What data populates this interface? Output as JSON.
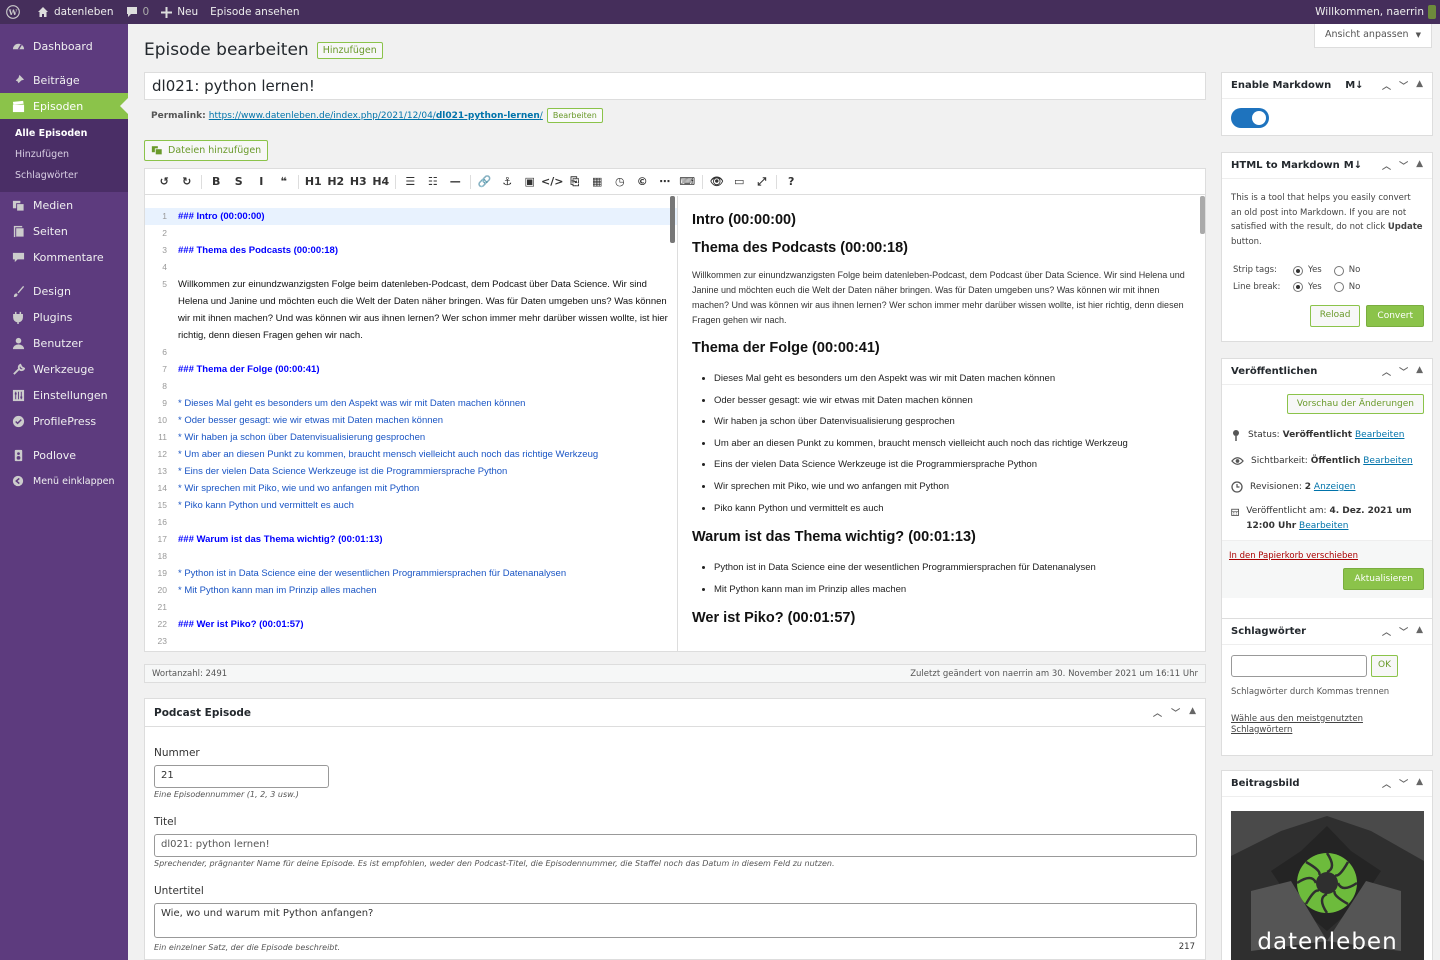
{
  "adminbar": {
    "site": "datenleben",
    "comments": "0",
    "new": "Neu",
    "view": "Episode ansehen",
    "welcome": "Willkommen, naerrin"
  },
  "sidebar": {
    "items": [
      {
        "label": "Dashboard",
        "icon": "dashboard-icon"
      },
      {
        "label": "Beiträge",
        "icon": "pin-icon"
      },
      {
        "label": "Episoden",
        "icon": "clapper-icon"
      }
    ],
    "sub": [
      "Alle Episoden",
      "Hinzufügen",
      "Schlagwörter"
    ],
    "items2": [
      {
        "label": "Medien",
        "icon": "media-icon"
      },
      {
        "label": "Seiten",
        "icon": "page-icon"
      },
      {
        "label": "Kommentare",
        "icon": "comment-icon"
      }
    ],
    "items3": [
      {
        "label": "Design",
        "icon": "brush-icon"
      },
      {
        "label": "Plugins",
        "icon": "plug-icon"
      },
      {
        "label": "Benutzer",
        "icon": "user-icon"
      },
      {
        "label": "Werkzeuge",
        "icon": "wrench-icon"
      },
      {
        "label": "Einstellungen",
        "icon": "settings-icon"
      },
      {
        "label": "ProfilePress",
        "icon": "profile-icon"
      }
    ],
    "items4": [
      {
        "label": "Podlove",
        "icon": "podlove-icon"
      },
      {
        "label": "Menü einklappen",
        "icon": "collapse-icon"
      }
    ]
  },
  "page": {
    "title": "Episode bearbeiten",
    "add": "Hinzufügen",
    "screen_options": "Ansicht anpassen",
    "post_title": "dl021: python lernen!",
    "permalink_label": "Permalink:",
    "permalink_base": "https://www.datenleben.de/index.php/2021/12/04/",
    "permalink_slug": "dl021-python-lernen",
    "permalink_suffix": "/",
    "permalink_edit": "Bearbeiten",
    "add_files": "Dateien hinzufügen"
  },
  "toolbar": [
    "↺",
    "↻",
    "|",
    "B",
    "S",
    "I",
    "❝",
    "|",
    "H1",
    "H2",
    "H3",
    "H4",
    "|",
    "☰",
    "☷",
    "—",
    "|",
    "🔗",
    "⚓",
    "▣",
    "</>",
    "⎘",
    "▦",
    "◷",
    "©",
    "⋯",
    "⌨",
    "|",
    "👁",
    "▭",
    "⤢",
    "|",
    "?"
  ],
  "code_lines": [
    {
      "n": "1",
      "t": "### Intro (00:00:00)",
      "k": "hd"
    },
    {
      "n": "2",
      "t": "",
      "k": ""
    },
    {
      "n": "3",
      "t": "### Thema des Podcasts (00:00:18)",
      "k": "hd"
    },
    {
      "n": "4",
      "t": "",
      "k": ""
    },
    {
      "n": "5",
      "t": "Willkommen zur einundzwanzigsten Folge beim datenleben-Podcast, dem Podcast über Data Science. Wir sind Helena und Janine und möchten euch die Welt der Daten näher bringen. Was für Daten umgeben uns? Was können wir mit ihnen machen? Und was können wir aus ihnen lernen? Wer schon immer mehr darüber wissen wollte, ist hier richtig, denn diesen Fragen gehen wir nach.",
      "k": ""
    },
    {
      "n": "6",
      "t": "",
      "k": ""
    },
    {
      "n": "7",
      "t": "### Thema der Folge (00:00:41)",
      "k": "hd"
    },
    {
      "n": "8",
      "t": "",
      "k": ""
    },
    {
      "n": "9",
      "t": "* Dieses Mal geht es besonders um den Aspekt was wir mit Daten machen können",
      "k": "li"
    },
    {
      "n": "10",
      "t": "* Oder besser gesagt: wie wir etwas mit Daten machen können",
      "k": "li"
    },
    {
      "n": "11",
      "t": "* Wir haben ja schon über Datenvisualisierung gesprochen",
      "k": "li"
    },
    {
      "n": "12",
      "t": "* Um aber an diesen Punkt zu kommen, braucht mensch vielleicht auch noch das richtige Werkzeug",
      "k": "li"
    },
    {
      "n": "13",
      "t": "* Eins der vielen Data Science Werkzeuge ist die Programmiersprache Python",
      "k": "li"
    },
    {
      "n": "14",
      "t": "* Wir sprechen mit Piko, wie und wo anfangen mit Python",
      "k": "li"
    },
    {
      "n": "15",
      "t": "* Piko kann Python und vermittelt es auch",
      "k": "li"
    },
    {
      "n": "16",
      "t": "",
      "k": ""
    },
    {
      "n": "17",
      "t": "### Warum ist das Thema wichtig? (00:01:13)",
      "k": "hd"
    },
    {
      "n": "18",
      "t": "",
      "k": ""
    },
    {
      "n": "19",
      "t": "* Python ist in Data Science eine der wesentlichen Programmiersprachen für Datenanalysen",
      "k": "li"
    },
    {
      "n": "20",
      "t": "* Mit Python kann man im Prinzip alles machen",
      "k": "li"
    },
    {
      "n": "21",
      "t": "",
      "k": ""
    },
    {
      "n": "22",
      "t": "### Wer ist Piko? (00:01:57)",
      "k": "hd"
    },
    {
      "n": "23",
      "t": "",
      "k": ""
    }
  ],
  "preview": {
    "h_intro": "Intro (00:00:00)",
    "h_thema": "Thema des Podcasts (00:00:18)",
    "p_welcome": "Willkommen zur einundzwanzigsten Folge beim datenleben-Podcast, dem Podcast über Data Science. Wir sind Helena und Janine und möchten euch die Welt der Daten näher bringen. Was für Daten umgeben uns? Was können wir mit ihnen machen? Und was können wir aus ihnen lernen? Wer schon immer mehr darüber wissen wollte, ist hier richtig, denn diesen Fragen gehen wir nach.",
    "h_folge": "Thema der Folge (00:00:41)",
    "list1": [
      "Dieses Mal geht es besonders um den Aspekt was wir mit Daten machen können",
      "Oder besser gesagt: wie wir etwas mit Daten machen können",
      "Wir haben ja schon über Datenvisualisierung gesprochen",
      "Um aber an diesen Punkt zu kommen, braucht mensch vielleicht auch noch das richtige Werkzeug",
      "Eins der vielen Data Science Werkzeuge ist die Programmiersprache Python",
      "Wir sprechen mit Piko, wie und wo anfangen mit Python",
      "Piko kann Python und vermittelt es auch"
    ],
    "h_warum": "Warum ist das Thema wichtig? (00:01:13)",
    "list2": [
      "Python ist in Data Science eine der wesentlichen Programmiersprachen für Datenanalysen",
      "Mit Python kann man im Prinzip alles machen"
    ],
    "h_piko": "Wer ist Piko? (00:01:57)"
  },
  "status": {
    "wordcount": "Wortanzahl: 2491",
    "lastedit": "Zuletzt geändert von naerrin am 30. November 2021 um 16:11 Uhr"
  },
  "podcast": {
    "title": "Podcast Episode",
    "num_label": "Nummer",
    "num_value": "21",
    "num_hint": "Eine Episodennummer (1, 2, 3 usw.)",
    "title_label": "Titel",
    "title_value": "dl021: python lernen!",
    "title_hint": "Sprechender, prägnanter Name für deine Episode. Es ist empfohlen, weder den Podcast-Titel, die Episodennummer, die Staffel noch das Datum in diesem Feld zu nutzen.",
    "sub_label": "Untertitel",
    "sub_value": "Wie, wo und warum mit Python anfangen?",
    "sub_hint": "Ein einzelner Satz, der die Episode beschreibt.",
    "sub_count": "217"
  },
  "markdown": {
    "title": "Enable Markdown",
    "badge": "M↓",
    "enabled": true
  },
  "html2md": {
    "title": "HTML to Markdown",
    "badge": "M↓",
    "desc1": "This is a tool that helps you easily convert an old post into Markdown. If you are not satisfied with the result, do not click ",
    "desc_bold": "Update",
    "desc2": " button.",
    "strip_label": "Strip tags:",
    "line_label": "Line break:",
    "yes": "Yes",
    "no": "No",
    "reload": "Reload",
    "convert": "Convert"
  },
  "publish": {
    "title": "Veröffentlichen",
    "preview": "Vorschau der Änderungen",
    "status_label": "Status:",
    "status_value": "Veröffentlicht",
    "vis_label": "Sichtbarkeit:",
    "vis_value": "Öffentlich",
    "rev_label": "Revisionen:",
    "rev_value": "2",
    "rev_link": "Anzeigen",
    "pub_label": "Veröffentlicht am:",
    "pub_value": "4. Dez. 2021 um 12:00 Uhr",
    "edit": "Bearbeiten",
    "trash": "In den Papierkorb verschieben",
    "update": "Aktualisieren"
  },
  "tags": {
    "title": "Schlagwörter",
    "ok": "OK",
    "hint": "Schlagwörter durch Kommas trennen",
    "choose": "Wähle aus den meistgenutzten Schlagwörtern"
  },
  "thumb": {
    "title": "Beitragsbild",
    "logo_text": "datenleben"
  },
  "colors": {
    "adminbar": "#452e5b",
    "sidebar": "#5d3b7e",
    "accent": "#8bc34a",
    "link": "#0073aa",
    "heading_code": "#0000ff"
  }
}
